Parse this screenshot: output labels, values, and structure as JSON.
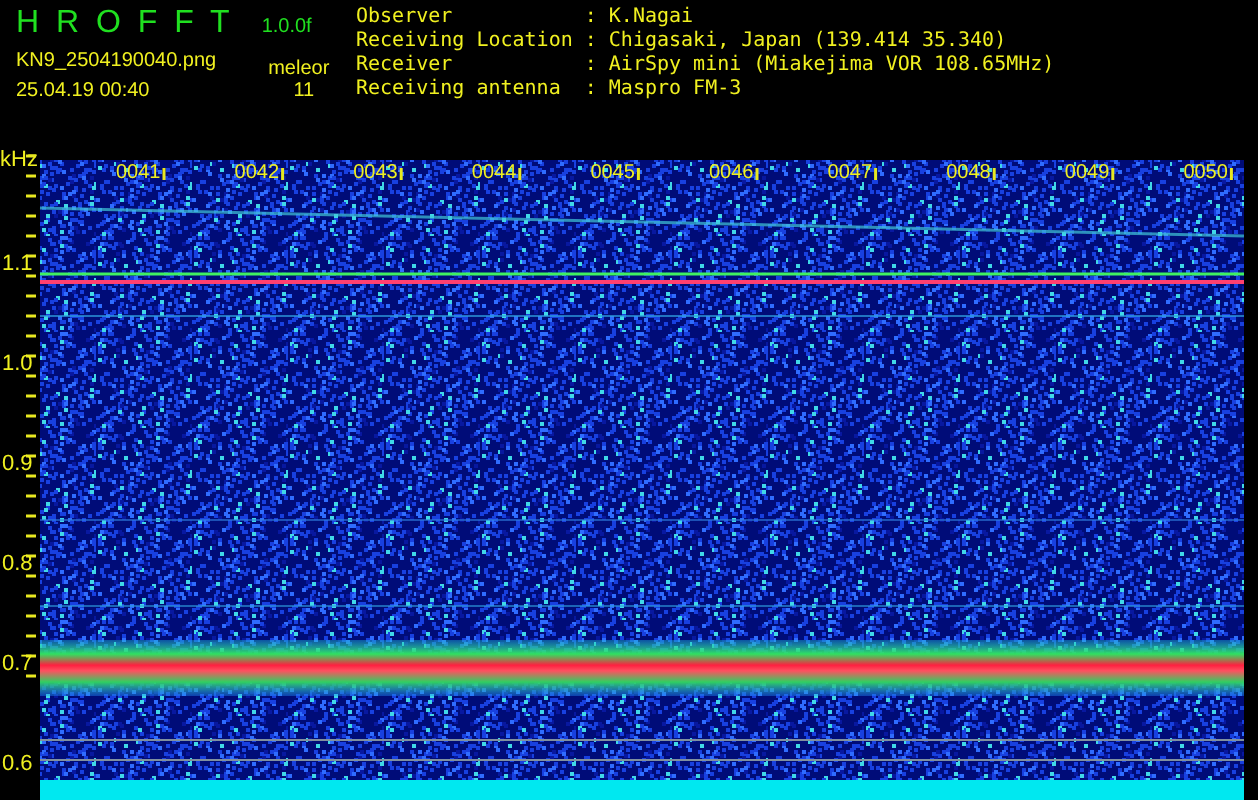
{
  "header": {
    "title": "H R O F F T",
    "version": "1.0.0f",
    "file_name": "KN9_2504190040.png",
    "timestamp": "25.04.19 00:40",
    "mode_label": "meleor",
    "count": "11"
  },
  "station_info": [
    {
      "label": "Observer",
      "separator": ":",
      "value": "K.Nagai"
    },
    {
      "label": "Receiving Location",
      "separator": ":",
      "value": "Chigasaki, Japan (139.414 35.340)"
    },
    {
      "label": "Receiver",
      "separator": ":",
      "value": "AirSpy mini (Miakejima VOR 108.65MHz)"
    },
    {
      "label": "Receiving antenna",
      "separator": ":",
      "value": "Maspro FM-3"
    }
  ],
  "spectrogram": {
    "unit": "kHz",
    "y_labels": [
      "1.1",
      "1.0",
      "0.9",
      "0.8",
      "0.7",
      "0.6"
    ],
    "time_labels": [
      "0041",
      "0042",
      "0043",
      "0044",
      "0045",
      "0046",
      "0047",
      "0048",
      "0049",
      "0050"
    ]
  }
}
